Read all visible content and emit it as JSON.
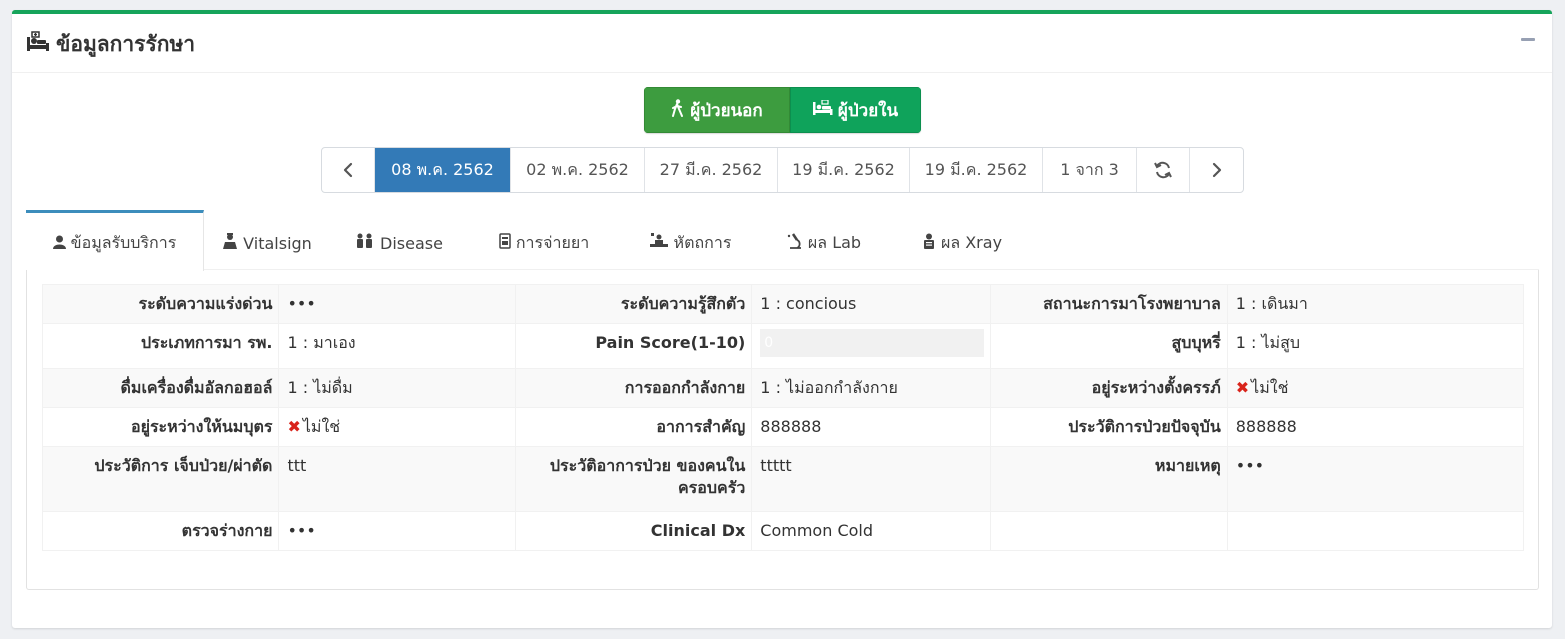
{
  "box": {
    "title": "ข้อมูลการรักษา",
    "title_icon": "bed-patient-icon",
    "accent_color": "#16a45b",
    "collapse_icon": "minus-icon"
  },
  "patient_type": {
    "outpatient_label": "ผู้ป่วยนอก",
    "outpatient_icon": "walking-icon",
    "inpatient_label": "ผู้ป่วยใน",
    "inpatient_icon": "bed-icon"
  },
  "visit_pager": {
    "prev_icon": "chevron-left-icon",
    "dates": [
      "08 พ.ค. 2562",
      "02 พ.ค. 2562",
      "27 มี.ค. 2562",
      "19 มี.ค. 2562",
      "19 มี.ค. 2562"
    ],
    "active_index": 0,
    "page_info": "1 จาก 3",
    "refresh_icon": "refresh-icon",
    "next_icon": "chevron-right-icon",
    "active_color": "#337ab7"
  },
  "tabs": [
    {
      "label": "ข้อมูลรับบริการ",
      "icon": "user-icon",
      "active": true
    },
    {
      "label": "Vitalsign",
      "icon": "doctor-icon",
      "active": false
    },
    {
      "label": "Disease",
      "icon": "users-icon",
      "active": false
    },
    {
      "label": "การจ่ายยา",
      "icon": "prescription-icon",
      "active": false
    },
    {
      "label": "หัตถการ",
      "icon": "procedure-icon",
      "active": false
    },
    {
      "label": "ผล Lab",
      "icon": "microscope-icon",
      "active": false
    },
    {
      "label": "ผล Xray",
      "icon": "xray-icon",
      "active": false
    }
  ],
  "service_info": {
    "rows": [
      [
        {
          "label": "ระดับความแร่งด่วน",
          "value": "•••"
        },
        {
          "label": "ระดับความรู้สึกตัว",
          "value": "1 : concious"
        },
        {
          "label": "สถานะการมาโรงพยาบาล",
          "value": "1 : เดินมา"
        }
      ],
      [
        {
          "label": "ประเภทการมา รพ.",
          "value": "1 : มาเอง"
        },
        {
          "label": "Pain Score(1-10)",
          "value": "0"
        },
        {
          "label": "สูบบุหรี่",
          "value": "1 : ไม่สูบ"
        }
      ],
      [
        {
          "label": "ดื่มเครื่องดื่มอัลกอฮอล์",
          "value": "1 : ไม่ดื่ม"
        },
        {
          "label": "การออกกำลังกาย",
          "value": "1 : ไม่ออกกำลังกาย"
        },
        {
          "label": "อยู่ระหว่างตั้งครรภ์",
          "value": "ไม่ใช่",
          "mark": "✖"
        }
      ],
      [
        {
          "label": "อยู่ระหว่างให้นมบุตร",
          "value": "ไม่ใช่",
          "mark": "✖"
        },
        {
          "label": "อาการสำคัญ",
          "value": "888888"
        },
        {
          "label": "ประวัติการป่วยปัจจุบัน",
          "value": "888888"
        }
      ],
      [
        {
          "label": "ประวัติการ เจ็บป่วย/ผ่าตัด",
          "value": "ttt"
        },
        {
          "label": "ประวัติอาการป่วย ของคนในครอบครัว",
          "value": "ttttt"
        },
        {
          "label": "หมายเหตุ",
          "value": "•••"
        }
      ],
      [
        {
          "label": "ตรวจร่างกาย",
          "value": "•••"
        },
        {
          "label": "Clinical Dx",
          "value": "Common Cold"
        },
        {
          "label": "",
          "value": ""
        }
      ]
    ]
  }
}
